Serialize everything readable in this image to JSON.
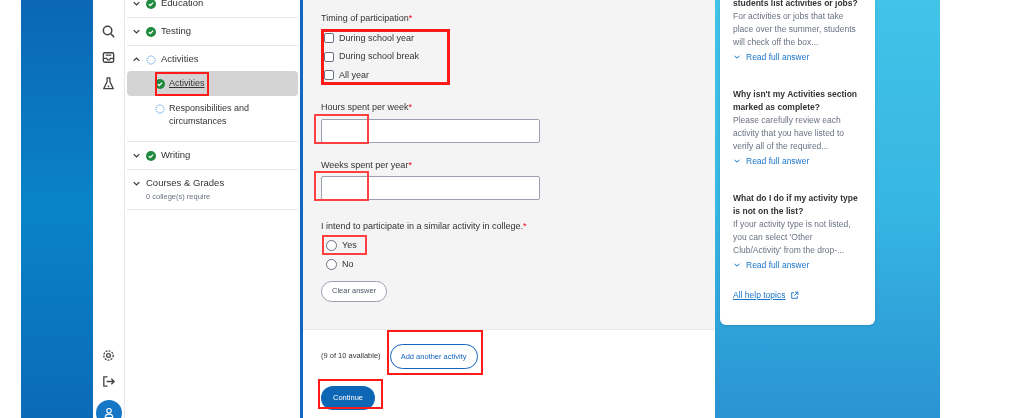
{
  "rail": {
    "top_icons": [
      {
        "kind": "search"
      },
      {
        "kind": "inbox"
      },
      {
        "kind": "flask"
      }
    ],
    "bottom_icons": [
      {
        "kind": "settings"
      },
      {
        "kind": "sign-out"
      }
    ]
  },
  "nav": [
    {
      "label": "Education",
      "kind": "complete",
      "expanded": false
    },
    {
      "label": "Testing",
      "kind": "complete",
      "expanded": false
    },
    {
      "label": "Activities",
      "kind": "in-progress",
      "expanded": true,
      "children": [
        {
          "label": "Activities",
          "kind": "complete",
          "selected": true,
          "highlighted": true
        },
        {
          "label": "Responsibilities and circumstances",
          "kind": "in-progress",
          "selected": false,
          "highlighted": false
        }
      ]
    },
    {
      "label": "Writing",
      "kind": "complete",
      "expanded": false
    },
    {
      "label": "Courses & Grades",
      "kind": "plain",
      "expanded": false,
      "note": "0 college(s) require"
    }
  ],
  "form": {
    "timing": {
      "label": "Timing of participation",
      "required_mark": "*",
      "highlighted": true,
      "options": [
        {
          "label": "During school year",
          "checked": false
        },
        {
          "label": "During school break",
          "checked": false
        },
        {
          "label": "All year",
          "checked": false
        }
      ]
    },
    "fields": [
      {
        "label": "Hours spent per week",
        "required_mark": "*",
        "highlighted": true
      },
      {
        "label": "Weeks spent per year",
        "required_mark": "*",
        "highlighted": true
      }
    ],
    "intent": {
      "label": "I intend to participate in a similar activity in college.",
      "required_mark": "*",
      "options": [
        {
          "label": "Yes",
          "selected": false,
          "highlighted": true
        },
        {
          "label": "No",
          "selected": false,
          "highlighted": false
        }
      ],
      "clear_button": "Clear answer"
    },
    "available": "(9 of 10 available)",
    "add_button": {
      "label": "Add another activity",
      "highlighted": true
    },
    "continue_button": {
      "label": "Continue",
      "highlighted": true
    }
  },
  "help": {
    "items": [
      {
        "question": "students list activities or jobs?",
        "answer": "For activities or jobs that take place over the summer, students will check off the box...",
        "link": "Read full answer"
      },
      {
        "question": "Why isn't my Activities section marked as complete?",
        "answer": "Please carefully review each activity that you have listed to verify all of the required...",
        "link": "Read full answer"
      },
      {
        "question": "What do I do if my activity type is not on the list?",
        "answer": "If your activity type is not listed, you can select 'Other Club/Activity' from the drop-...",
        "link": "Read full answer"
      }
    ],
    "all_link": "All help topics"
  }
}
